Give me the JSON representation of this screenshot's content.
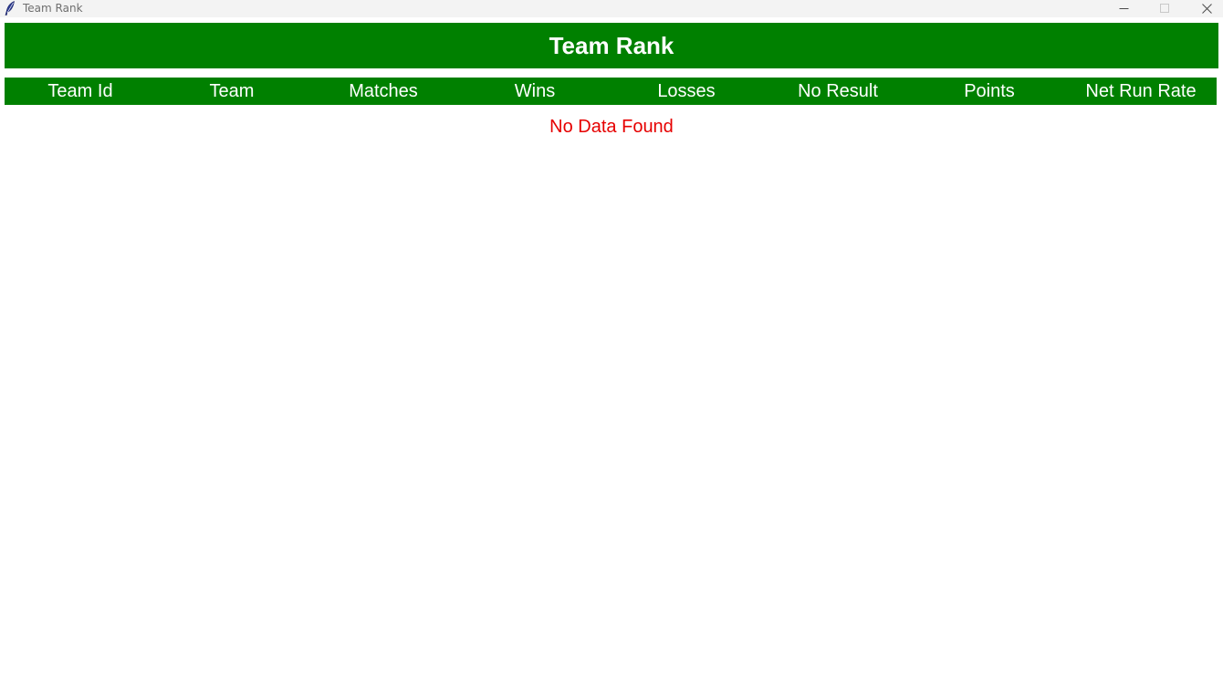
{
  "window": {
    "title": "Team Rank",
    "icon": "feather-icon",
    "controls": {
      "minimize": "minimize-icon",
      "maximize": "maximize-icon",
      "close": "close-icon"
    }
  },
  "header": {
    "title": "Team Rank"
  },
  "table": {
    "columns": [
      "Team Id",
      "Team",
      "Matches",
      "Wins",
      "Losses",
      "No Result",
      "Points",
      "Net Run Rate"
    ],
    "rows": []
  },
  "empty_message": "No Data Found",
  "colors": {
    "header_background": "#008000",
    "header_text": "#ffffff",
    "empty_message_text": "#e60000"
  }
}
